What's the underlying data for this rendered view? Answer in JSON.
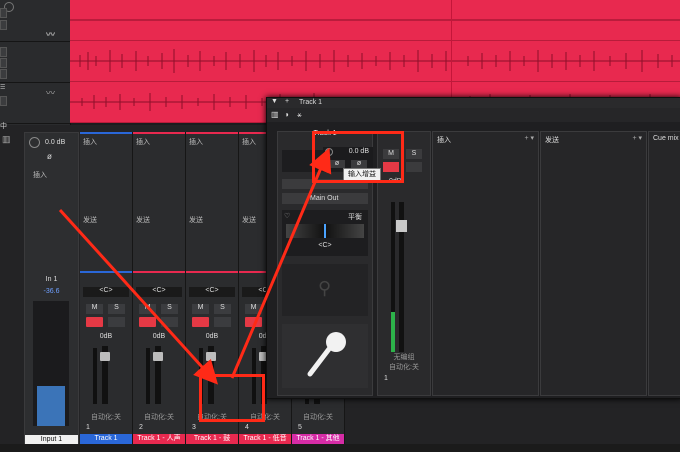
{
  "tracks_top": {
    "header_glyph": "中"
  },
  "mixer": {
    "input_strip": {
      "gain_value": "0.0 dB",
      "phase_symbol": "ø",
      "insert_label": "插入",
      "name": "In 1",
      "level": "-36.6",
      "label": "Input 1"
    },
    "strips": [
      {
        "insert": "插入",
        "send": "发送",
        "pan": "<C>",
        "mute": "M",
        "solo": "S",
        "db": "0dB",
        "auto": "自动化:关",
        "num": "1",
        "label": "Track 1",
        "color": "#2a67d8"
      },
      {
        "insert": "插入",
        "send": "发送",
        "pan": "<C>",
        "mute": "M",
        "solo": "S",
        "db": "0dB",
        "auto": "自动化:关",
        "num": "2",
        "label": "Track 1 - 人声",
        "color": "#e8294f"
      },
      {
        "insert": "插入",
        "send": "发送",
        "pan": "<C>",
        "mute": "M",
        "solo": "S",
        "db": "0dB",
        "auto": "自动化:关",
        "num": "3",
        "label": "Track 1 - 鼓",
        "color": "#e8294f"
      },
      {
        "insert": "插入",
        "send": "发送",
        "pan": "<C>",
        "mute": "M",
        "solo": "S",
        "db": "0dB",
        "auto": "自动化:关",
        "num": "4",
        "label": "Track 1 - 低音",
        "color": "#e8294f"
      },
      {
        "insert": "",
        "send": "",
        "pan": "<C>",
        "mute": "M",
        "solo": "S",
        "db": "0dB",
        "auto": "自动化:关",
        "num": "5",
        "label": "Track 1 - 其他",
        "color": "#d62ca6"
      }
    ]
  },
  "panel": {
    "title": "Track 1",
    "plus": "+",
    "channel_name": "Track 1",
    "gain_value": "0.0 dB",
    "phase_a": "ø",
    "phase_b": "ø",
    "mute": "M",
    "solo": "S",
    "db_readout": "0dB",
    "output": "Main Out",
    "pan_label": "平衡",
    "pan_value": "<C>",
    "tooltip": "输入增益",
    "auto_state": "无编组",
    "auto": "自动化:关",
    "num": "1",
    "inserts_title": "插入",
    "sends_title": "发送",
    "cue_title": "Cue mix"
  },
  "colors": {
    "accent_red": "#ff2a17",
    "clip_pink": "#e8294f",
    "track_blue": "#2a67d8"
  }
}
